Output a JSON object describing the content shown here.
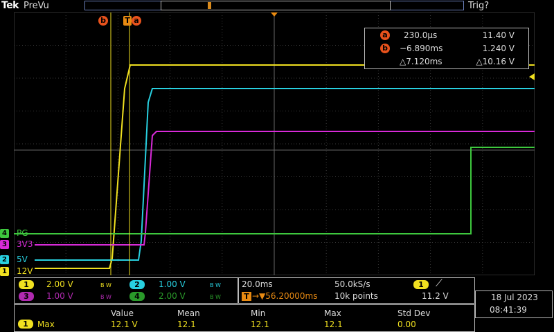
{
  "header": {
    "brand": "Tek",
    "mode": "PreVu",
    "trigger_status": "Trig?"
  },
  "cursor_flags": {
    "b": "b",
    "a": "a",
    "t": "T"
  },
  "cursor_readout": {
    "a": {
      "badge": "a",
      "time": "230.0µs",
      "volts": "11.40 V"
    },
    "b": {
      "badge": "b",
      "time": "−6.890ms",
      "volts": "1.240 V"
    },
    "delta": {
      "time": "△7.120ms",
      "volts": "△10.16 V"
    }
  },
  "channel_labels": [
    {
      "num": "4",
      "label": "PG",
      "color": "#3ec83e"
    },
    {
      "num": "3",
      "label": "3V3",
      "color": "#d82ad8"
    },
    {
      "num": "2",
      "label": "5V",
      "color": "#28d0e0"
    },
    {
      "num": "1",
      "label": "12V",
      "color": "#f0e020"
    }
  ],
  "colors": {
    "ch1": "#f0e020",
    "ch2": "#28d0e0",
    "ch3": "#d82ad8",
    "ch4": "#3ec83e",
    "cursor": "#e8521c",
    "trigger": "#e88a12"
  },
  "vertical": {
    "ch1": {
      "num": "1",
      "scale": "2.00 V",
      "bw": "B W"
    },
    "ch2": {
      "num": "2",
      "scale": "1.00 V",
      "bw": "B W"
    },
    "ch3": {
      "num": "3",
      "scale": "1.00 V",
      "bw": "B W"
    },
    "ch4": {
      "num": "4",
      "scale": "2.00 V",
      "bw": "B W"
    }
  },
  "horizontal": {
    "time_div": "20.0ms",
    "sample_rate": "50.0kS/s",
    "trigger_pos": "→▼56.20000ms",
    "record": "10k points",
    "trigger_tag": "T"
  },
  "trigger": {
    "source": "1",
    "slope_icon": "⟋",
    "level": "11.2 V"
  },
  "datetime": {
    "date": "18 Jul  2023",
    "time": "08:41:39"
  },
  "measurements": {
    "headers": [
      "Value",
      "Mean",
      "Min",
      "Max",
      "Std Dev"
    ],
    "row": {
      "source": "1",
      "name": "Max",
      "cells": [
        "12.1 V",
        "12.1",
        "12.1",
        "12.1",
        "0.00"
      ]
    }
  }
}
